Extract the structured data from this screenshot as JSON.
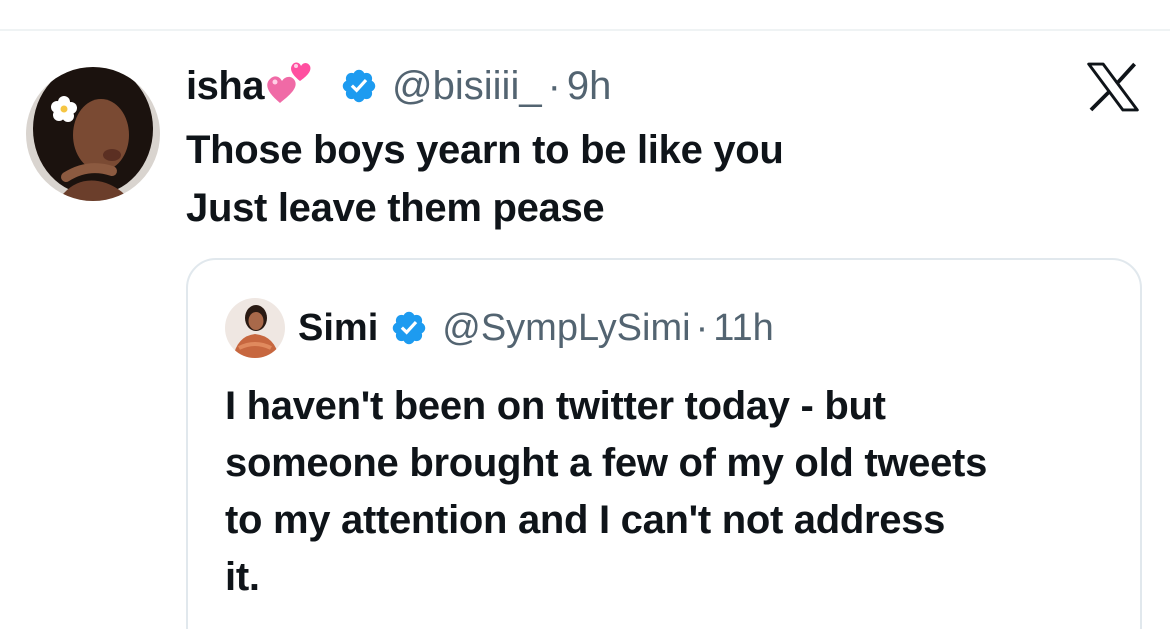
{
  "tweet": {
    "display_name": "isha",
    "name_emoji": "two-hearts-emoji",
    "handle": "@bisiiii_",
    "separator": "·",
    "time": "9h",
    "text_lines": [
      "Those boys yearn to be like you",
      "Just leave them pease"
    ]
  },
  "quoted_tweet": {
    "display_name": "Simi",
    "handle": "@SympLySimi",
    "separator": "·",
    "time": "11h",
    "text_lines": [
      "I haven't been on twitter today - but",
      "someone brought a few of my old tweets",
      "to my attention and I can't not address",
      "it."
    ]
  },
  "icons": {
    "verified": "verified-badge-icon",
    "brand": "x-logo-icon"
  },
  "colors": {
    "verified_blue": "#1d9bf0",
    "secondary_text": "#536471",
    "primary_text": "#0f1419",
    "border": "#e1e8ed"
  }
}
